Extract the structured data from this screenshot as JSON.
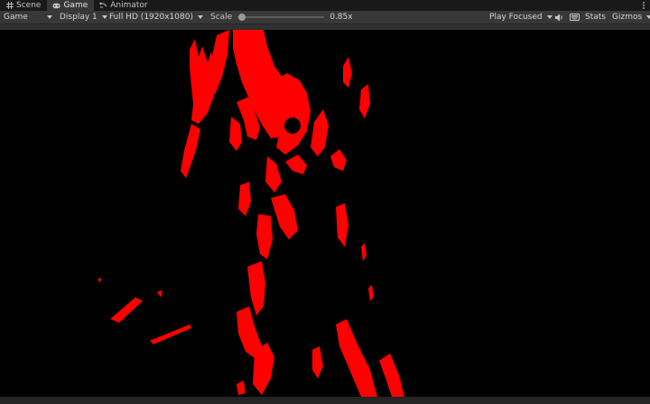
{
  "tabs": [
    {
      "label": "Scene",
      "icon": "grid-icon"
    },
    {
      "label": "Game",
      "icon": "gamepad-icon"
    },
    {
      "label": "Animator",
      "icon": "animator-icon"
    }
  ],
  "toolbar": {
    "view_mode": "Game",
    "display": "Display 1",
    "resolution": "Full HD (1920x1080)",
    "scale_label": "Scale",
    "scale_value": "0.85x",
    "scale_fraction": 0.05,
    "play_mode": "Play Focused",
    "stats_label": "Stats",
    "gizmos_label": "Gizmos"
  },
  "game_view": {
    "background": "#000000",
    "figure_color": "#ff0000"
  }
}
